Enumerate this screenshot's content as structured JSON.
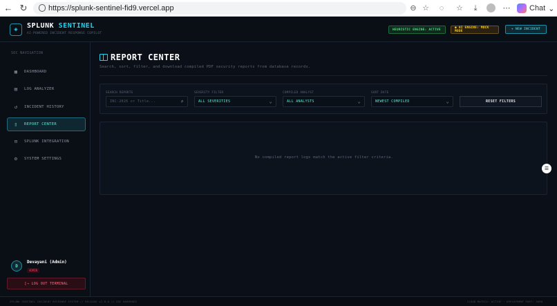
{
  "browser": {
    "url": "https://splunk-sentinel-fid9.vercel.app",
    "chat_label": "Chat"
  },
  "header": {
    "brand_prefix": "SPLUNK",
    "brand_accent": "SENTINEL",
    "brand_subtitle": "AI-POWERED INCIDENT RESPONSE COPILOT",
    "status_heuristic": "HEURISTIC ENGINE: ACTIVE",
    "status_ai": "● AI ENGINE: MOCK MODE",
    "new_incident": "+ NEW INCIDENT"
  },
  "sidebar": {
    "heading": "SOC NAVIGATION",
    "items": [
      {
        "label": "DASHBOARD",
        "icon": "grid-icon"
      },
      {
        "label": "LOG ANALYZER",
        "icon": "file-icon"
      },
      {
        "label": "INCIDENT HISTORY",
        "icon": "history-icon"
      },
      {
        "label": "REPORT CENTER",
        "icon": "book-icon",
        "active": true
      },
      {
        "label": "SPLUNK INTEGRATION",
        "icon": "database-icon"
      },
      {
        "label": "SYSTEM SETTINGS",
        "icon": "gear-icon"
      }
    ],
    "user": {
      "initial": "D",
      "name": "Devayani (Admin)",
      "role": "ADMIN"
    },
    "logout": "[→ LOG OUT TERMINAL"
  },
  "main": {
    "title": "REPORT CENTER",
    "subtitle": "Search, sort, filter, and download compiled PDF security reports from database records.",
    "filters": {
      "search_label": "SEARCH REPORTS",
      "search_placeholder": "INC-2026 or Title...",
      "severity_label": "SEVERITY FILTER",
      "severity_value": "ALL SEVERITIES",
      "analyst_label": "COMPILED ANALYST",
      "analyst_value": "ALL ANALYSTS",
      "sort_label": "SORT DATE",
      "sort_value": "NEWEST COMPILED",
      "reset": "RESET FILTERS"
    },
    "empty_message": "No compiled report logs match the active filter criteria."
  },
  "footer": {
    "left": "SPLUNK SENTINEL INCIDENT RESPONSE SYSTEM // RELEASE v2.0.0 // SOC HARDENED",
    "right": "CLOUD MATRIX: ACTIVE · DEPLOYMENT PORT: 3000"
  },
  "colors": {
    "accent": "#22d3ee",
    "background": "#0b0f17",
    "danger": "#f43f5e",
    "success": "#4ade80",
    "warning": "#facc15"
  }
}
